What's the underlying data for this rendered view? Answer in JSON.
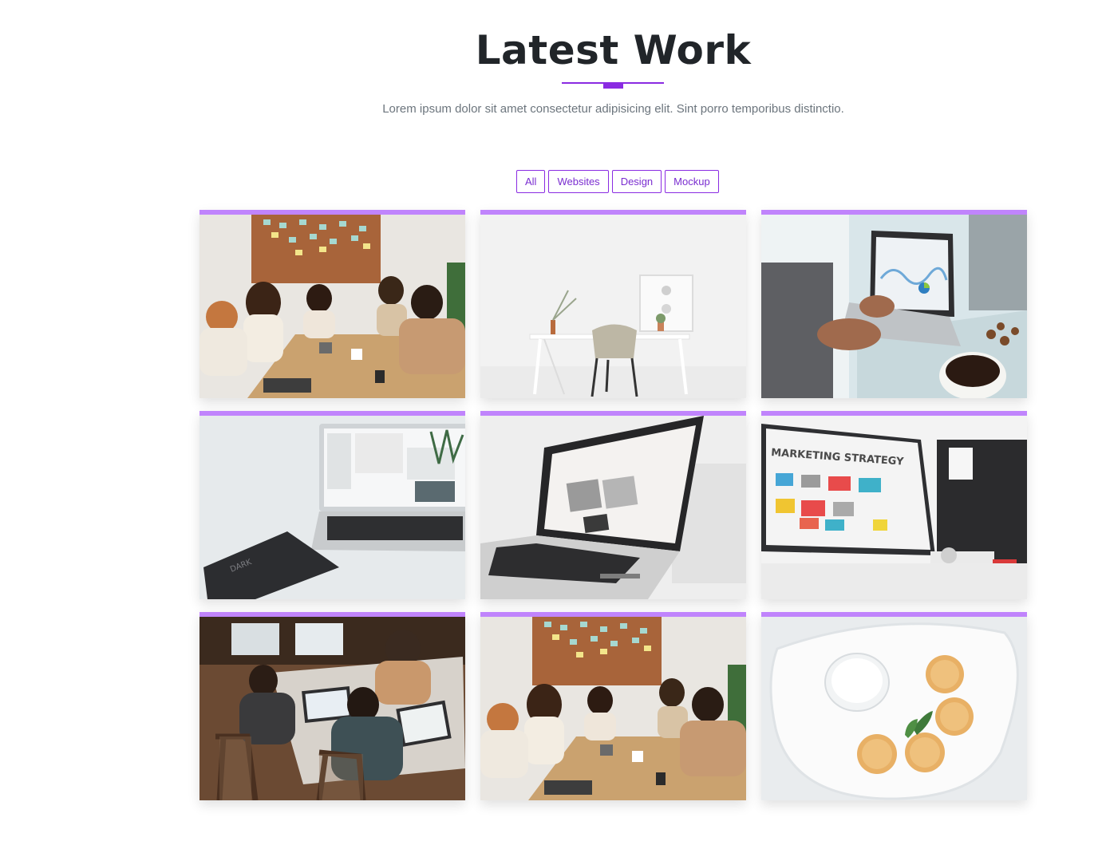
{
  "section": {
    "title": "Latest Work",
    "subtitle": "Lorem ipsum dolor sit amet consectetur adipisicing elit. Sint porro temporibus distinctio."
  },
  "filters": [
    {
      "label": "All"
    },
    {
      "label": "Websites"
    },
    {
      "label": "Design"
    },
    {
      "label": "Mockup"
    }
  ],
  "colors": {
    "accent": "#8a2be2",
    "card_bar": "#c084fc",
    "heading": "#212529",
    "muted": "#6c757d"
  },
  "portfolio": [
    {
      "image": "team-meeting-handshake-photo"
    },
    {
      "image": "minimal-desk-chair-photo"
    },
    {
      "image": "laptop-analytics-coffee-photo"
    },
    {
      "image": "laptop-notebook-desk-photo"
    },
    {
      "image": "laptop-website-angle-photo"
    },
    {
      "image": "marketing-strategy-monitor-photo"
    },
    {
      "image": "coworkers-laptops-table-photo"
    },
    {
      "image": "team-meeting-handshake-photo"
    },
    {
      "image": "pancakes-plate-photo"
    }
  ]
}
